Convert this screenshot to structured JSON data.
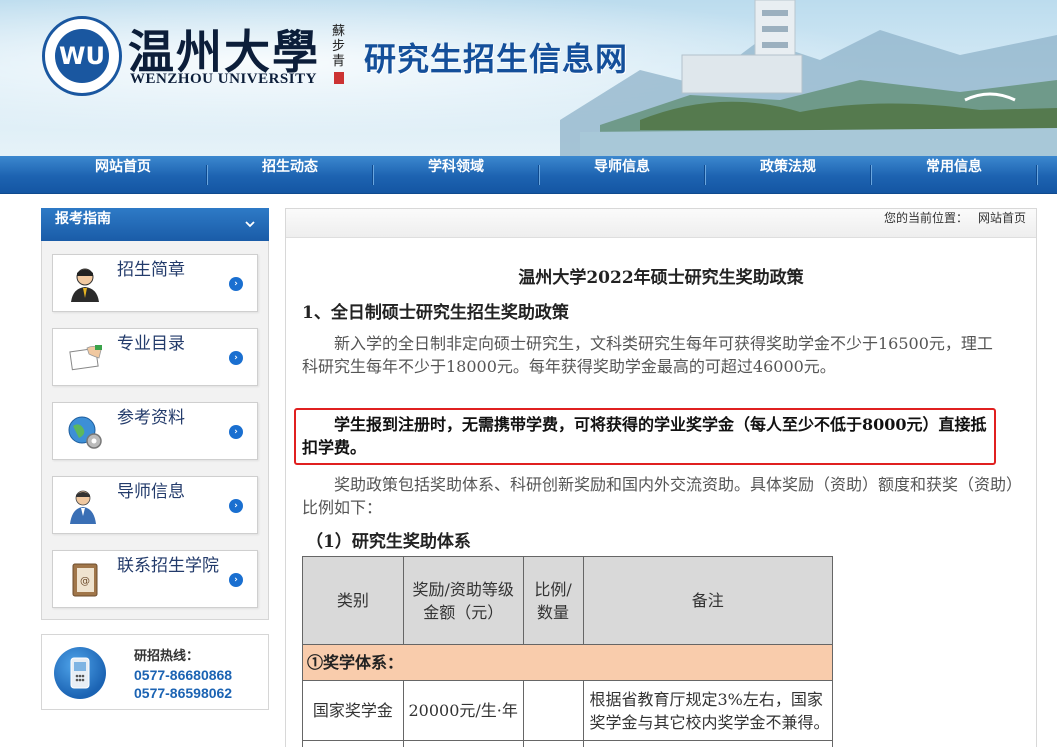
{
  "header": {
    "logo_text": "WU",
    "school_cn": "温州大學",
    "school_en": "WENZHOU UNIVERSITY",
    "calligraphy": "蘇步青",
    "site_title": "研究生招生信息网"
  },
  "nav": {
    "items": [
      {
        "label": "网站首页"
      },
      {
        "label": "招生动态"
      },
      {
        "label": "学科领域"
      },
      {
        "label": "导师信息"
      },
      {
        "label": "政策法规"
      },
      {
        "label": "常用信息"
      }
    ]
  },
  "sidebar": {
    "title": "报考指南",
    "items": [
      {
        "label": "招生简章",
        "icon": "user-icon"
      },
      {
        "label": "专业目录",
        "icon": "document-hand-icon"
      },
      {
        "label": "参考资料",
        "icon": "globe-gear-icon"
      },
      {
        "label": "导师信息",
        "icon": "teacher-icon"
      },
      {
        "label": "联系招生学院",
        "icon": "address-book-icon"
      }
    ],
    "hotline": {
      "title": "研招热线：",
      "numbers": [
        "0577-86680868",
        "0577-86598062"
      ]
    }
  },
  "breadcrumb": {
    "prefix": "您的当前位置：",
    "current": "网站首页"
  },
  "article": {
    "title": "温州大学2022年硕士研究生奖助政策",
    "section1": "1、全日制硕士研究生招生奖助政策",
    "para1": "新入学的全日制非定向硕士研究生，文科类研究生每年可获得奖助学金不少于16500元，理工科研究生每年不少于18000元。每年获得奖助学金最高的可超过46000元。",
    "para_highlight": "学生报到注册时，无需携带学费，可将获得的学业奖学金（每人至少不低于8000元）直接抵扣学费。",
    "para3": "奖助政策包括奖助体系、科研创新奖励和国内外交流资助。具体奖励（资助）额度和获奖（资助）比例如下：",
    "section2": "（1）研究生奖助体系",
    "table": {
      "headers": [
        "类别",
        "奖励/资助等级\n金额（元）",
        "比例/\n数量",
        "备注"
      ],
      "category": "①奖学体系：",
      "rows": [
        {
          "type": "国家奖学金",
          "amount": "20000元/生·年",
          "ratio": "",
          "note": "根据省教育厅规定3%左右，国家奖学金与其它校内奖学金不兼得。"
        }
      ]
    }
  }
}
